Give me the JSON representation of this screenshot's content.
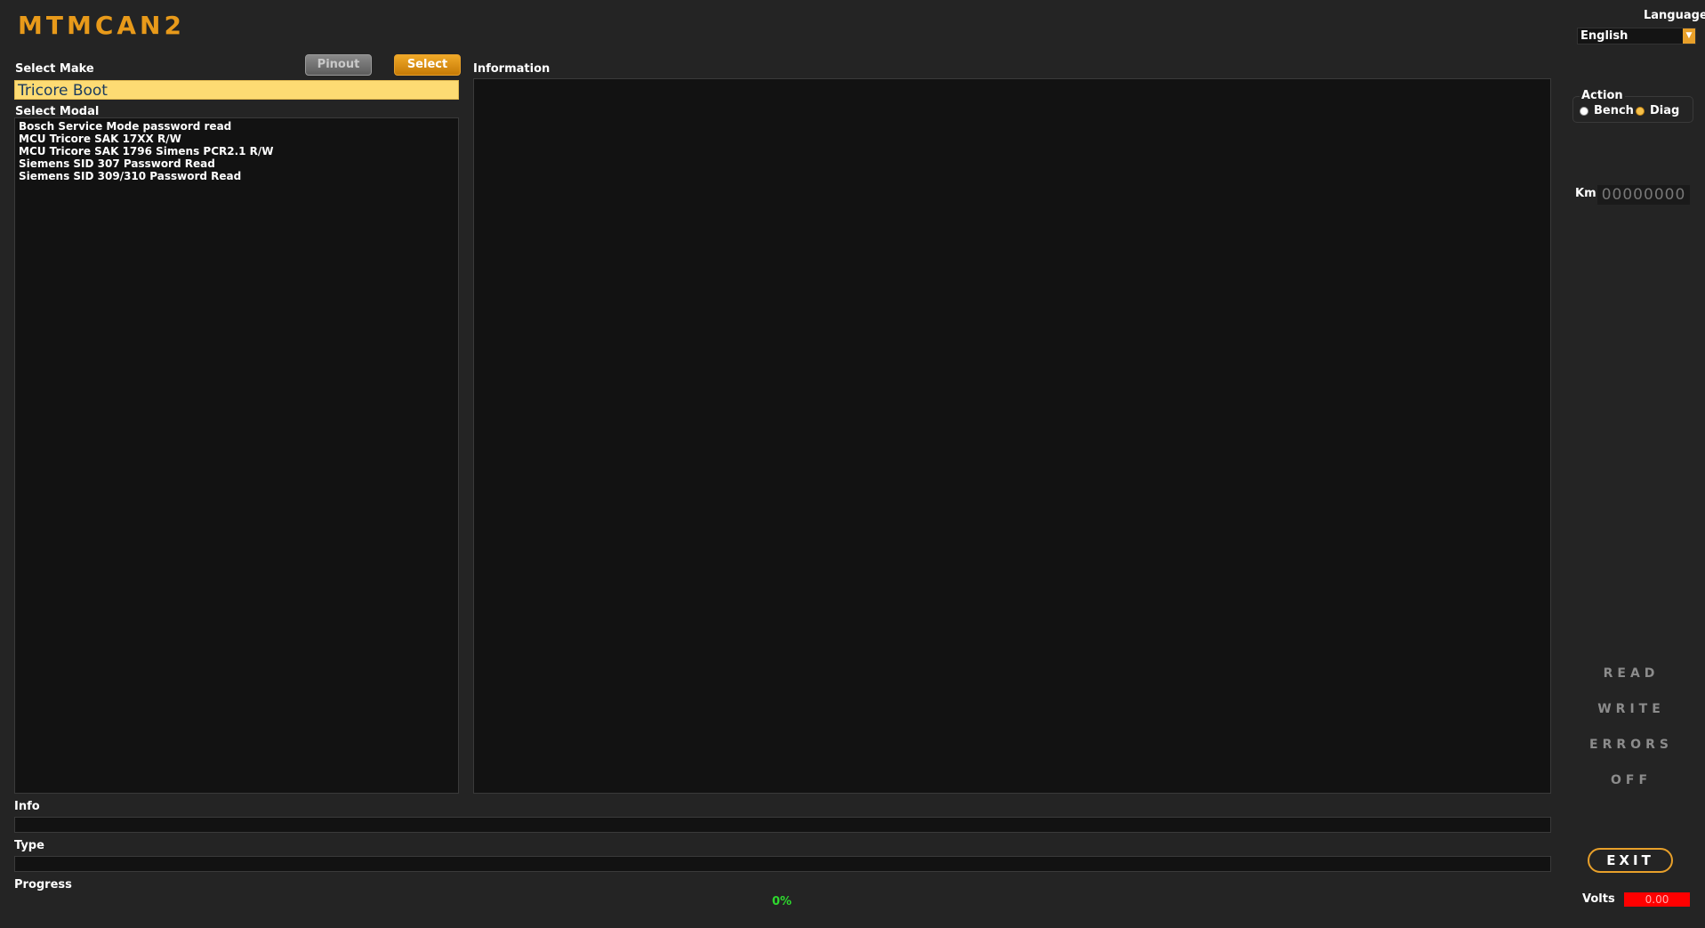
{
  "app": {
    "logo": "MTMCAN2"
  },
  "left": {
    "select_make_label": "Select Make",
    "pinout_label": "Pinout",
    "select_label": "Select",
    "make_value": "Tricore Boot",
    "select_modal_label": "Select Modal",
    "modal_items": [
      "Bosch Service Mode password read",
      "MCU Tricore SAK 17XX R/W",
      "MCU Tricore SAK 1796 Simens PCR2.1 R/W",
      "Siemens SID 307 Password Read",
      "Siemens SID 309/310 Password Read"
    ]
  },
  "main": {
    "information_label": "Information"
  },
  "bottom": {
    "info_label": "Info",
    "type_label": "Type",
    "progress_label": "Progress",
    "progress_value": "0%"
  },
  "right": {
    "language_label": "Language",
    "language_value": "English",
    "action_label": "Action",
    "bench_label": "Bench",
    "diag_label": "Diag",
    "selected_action": "Diag",
    "km_label": "Km",
    "km_value": "00000000",
    "read_label": "READ",
    "write_label": "WRITE",
    "errors_label": "ERRORS",
    "off_label": "OFF",
    "exit_label": "EXIT",
    "volts_label": "Volts",
    "volts_value": "0.00"
  },
  "colors": {
    "accent": "#e8a02a",
    "make_field_bg": "#fddb73",
    "progress_text": "#2ed82e",
    "volts_bg": "#ff0000"
  }
}
